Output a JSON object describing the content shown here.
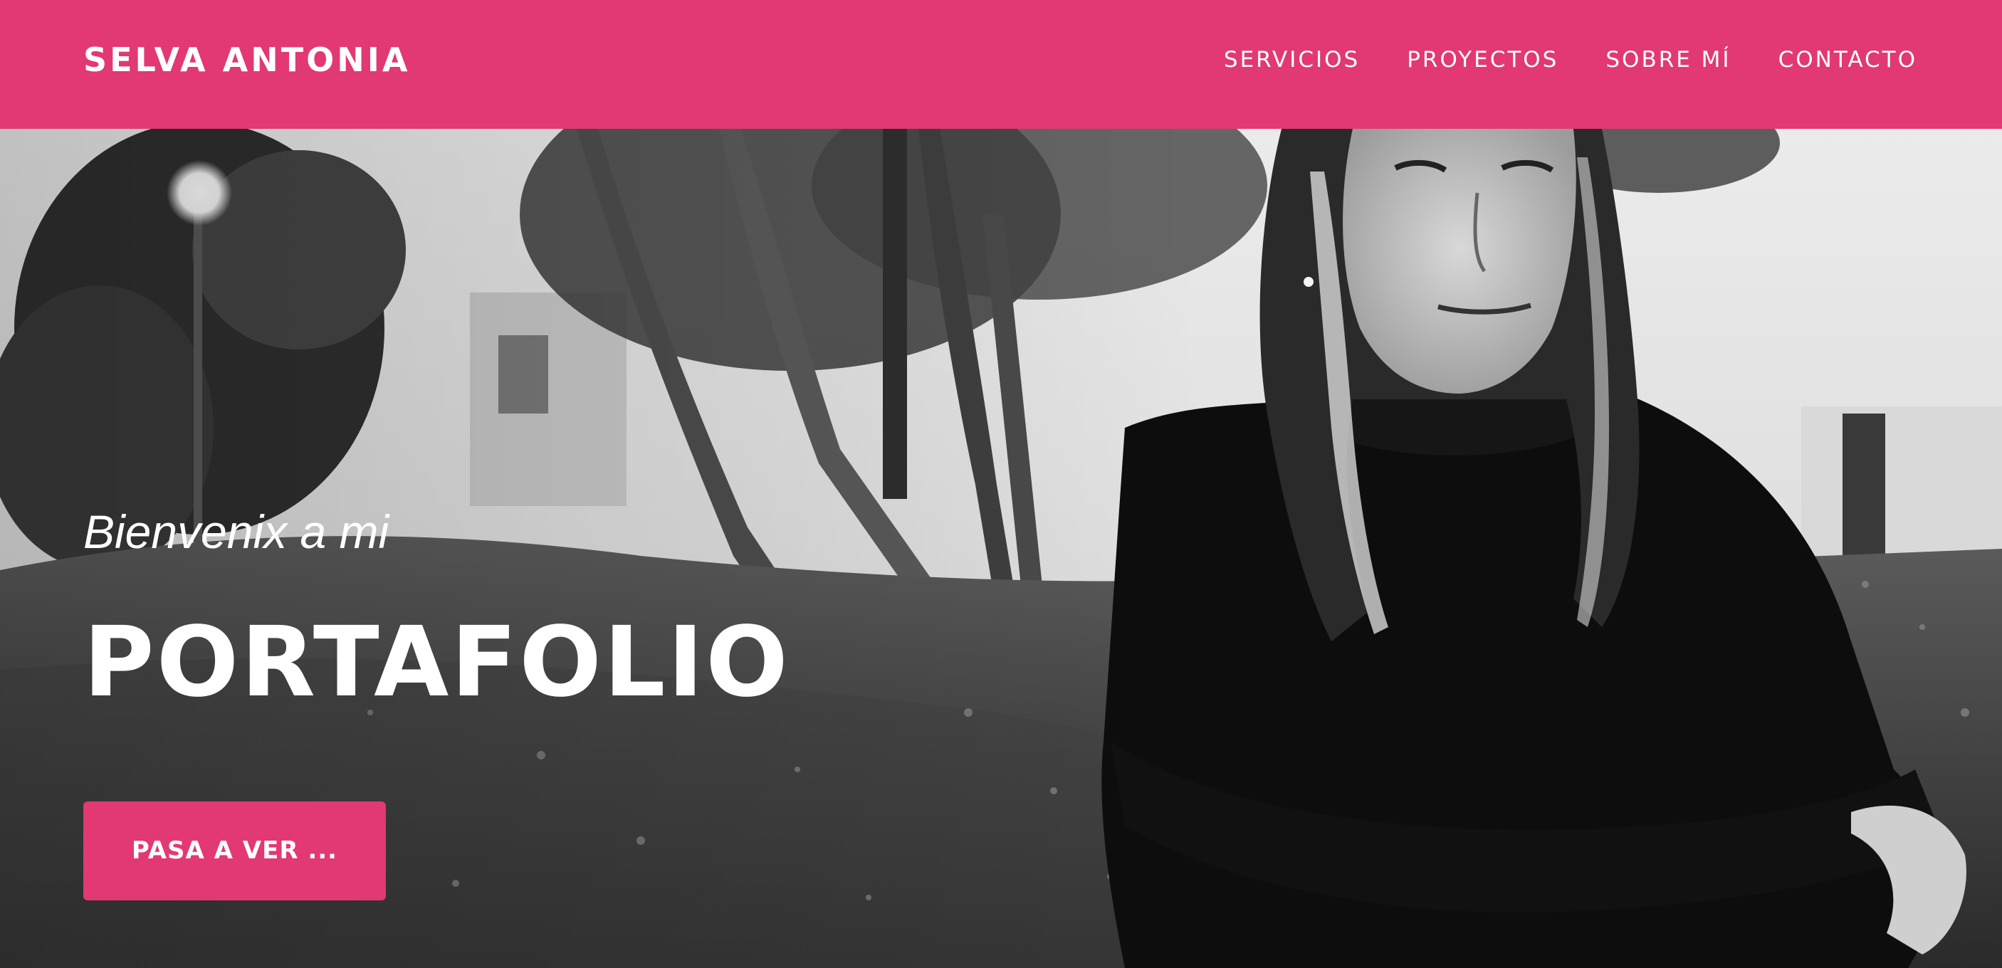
{
  "header": {
    "brand": "SELVA ANTONIA",
    "nav": [
      {
        "label": "SERVICIOS"
      },
      {
        "label": "PROYECTOS"
      },
      {
        "label": "SOBRE MÍ"
      },
      {
        "label": "CONTACTO"
      }
    ]
  },
  "hero": {
    "welcome": "Bienvenix a mi",
    "headline": "PORTAFOLIO",
    "cta_label": "PASA A VER ..."
  },
  "colors": {
    "accent": "#e23874",
    "text": "#ffffff"
  }
}
